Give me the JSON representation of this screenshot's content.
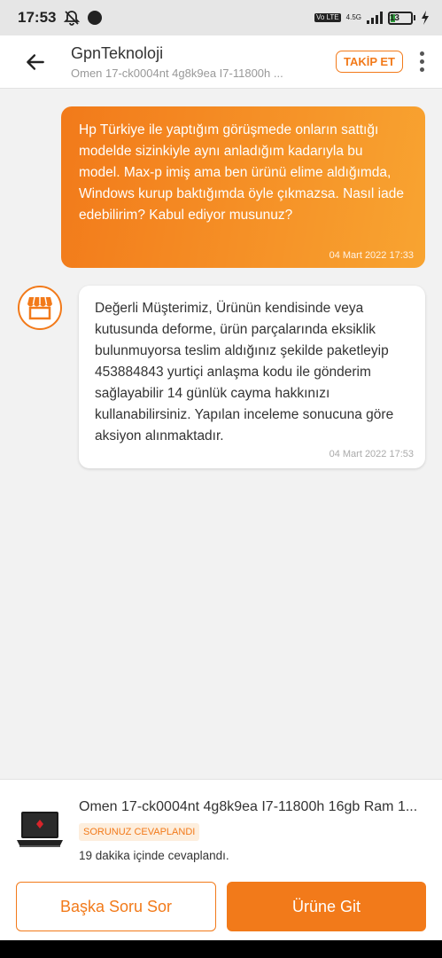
{
  "status_bar": {
    "time": "17:53",
    "volte": "Vo LTE",
    "network": "4.5G",
    "battery": "13"
  },
  "header": {
    "store_name": "GpnTeknoloji",
    "product_subtitle": "Omen 17-ck0004nt 4g8k9ea I7-11800h ...",
    "follow_label": "TAKİP ET"
  },
  "messages": [
    {
      "direction": "outgoing",
      "text": "Hp Türkiye ile yaptığım görüşmede onların sattığı modelde sizinkiyle aynı anladığım kadarıyla bu model. Max-p imiş ama ben ürünü elime aldığımda, Windows kurup baktığımda öyle çıkmazsa. Nasıl iade edebilirim? Kabul ediyor musunuz?",
      "time": "04 Mart 2022 17:33"
    },
    {
      "direction": "incoming",
      "text": "Değerli Müşterimiz, Ürünün kendisinde veya kutusunda deforme, ürün parçalarında eksiklik bulunmuyorsa teslim aldığınız şekilde paketleyip 453884843 yurtiçi anlaşma kodu ile gönderim sağlayabilir 14 günlük cayma hakkınızı kullanabilirsiniz. Yapılan inceleme sonucuna göre aksiyon alınmaktadır.",
      "time": "04 Mart 2022 17:53"
    }
  ],
  "product_card": {
    "name": "Omen 17-ck0004nt 4g8k9ea I7-11800h 16gb Ram 1...",
    "badge": "SORUNUZ CEVAPLANDI",
    "answered_time": "19 dakika içinde cevaplandı."
  },
  "buttons": {
    "ask_other": "Başka Soru Sor",
    "go_product": "Ürüne Git"
  },
  "colors": {
    "accent": "#f27a1a",
    "accent_light": "#f8a431",
    "badge_bg": "#fdeedd"
  }
}
